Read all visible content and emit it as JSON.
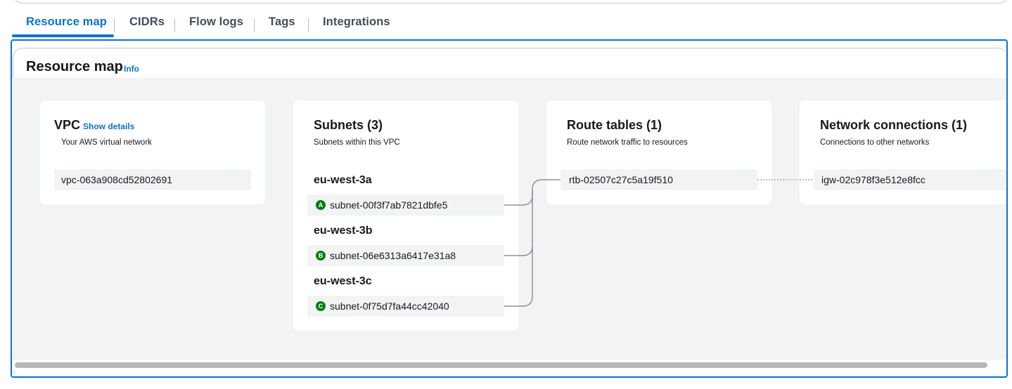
{
  "tabs": [
    {
      "label": "Resource map",
      "active": true
    },
    {
      "label": "CIDRs"
    },
    {
      "label": "Flow logs"
    },
    {
      "label": "Tags"
    },
    {
      "label": "Integrations"
    }
  ],
  "resource_map": {
    "title": "Resource map",
    "info_label": "Info",
    "vpc": {
      "title": "VPC",
      "show_details": "Show details",
      "subtitle": "Your AWS virtual network",
      "id": "vpc-063a908cd52802691"
    },
    "subnets": {
      "title": "Subnets (3)",
      "subtitle": "Subnets within this VPC",
      "zones": [
        {
          "name": "eu-west-3a",
          "badge": "A",
          "subnet": "subnet-00f3f7ab7821dbfe5"
        },
        {
          "name": "eu-west-3b",
          "badge": "B",
          "subnet": "subnet-06e6313a6417e31a8"
        },
        {
          "name": "eu-west-3c",
          "badge": "C",
          "subnet": "subnet-0f75d7fa44cc42040"
        }
      ]
    },
    "route_tables": {
      "title": "Route tables (1)",
      "subtitle": "Route network traffic to resources",
      "items": [
        "rtb-02507c27c5a19f510"
      ]
    },
    "network_connections": {
      "title": "Network connections (1)",
      "subtitle": "Connections to other networks",
      "items": [
        "igw-02c978f3e512e8fcc"
      ]
    }
  },
  "colors": {
    "accent": "#0972d3",
    "az_badge": "#037f0c",
    "canvas_bg": "#f2f3f3"
  }
}
